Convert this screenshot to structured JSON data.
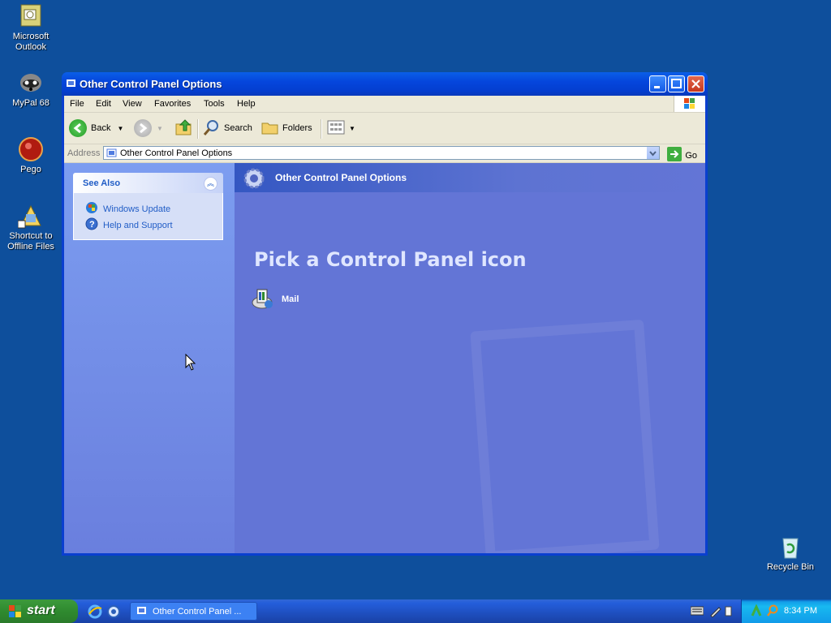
{
  "desktop": {
    "icons": [
      {
        "label": "Microsoft Outlook"
      },
      {
        "label": "MyPal 68"
      },
      {
        "label": "Pego"
      },
      {
        "label": "Shortcut to Offline Files"
      },
      {
        "label": "Recycle Bin"
      }
    ]
  },
  "window": {
    "title": "Other Control Panel Options",
    "menu": [
      "File",
      "Edit",
      "View",
      "Favorites",
      "Tools",
      "Help"
    ],
    "toolbar": {
      "back": "Back",
      "search": "Search",
      "folders": "Folders"
    },
    "address": {
      "label": "Address",
      "value": "Other Control Panel Options",
      "go": "Go"
    },
    "see_also": {
      "title": "See Also",
      "links": [
        "Windows Update",
        "Help and Support"
      ]
    },
    "header": "Other Control Panel Options",
    "pick_text": "Pick a Control Panel icon",
    "items": [
      {
        "label": "Mail"
      }
    ]
  },
  "taskbar": {
    "start": "start",
    "task": "Other Control Panel ...",
    "clock": "8:34 PM"
  },
  "colors": {
    "desktop": "#0e4f9c",
    "titlebar": "#0546dc",
    "content": "#6375d6",
    "start": "#2f8a2f"
  }
}
